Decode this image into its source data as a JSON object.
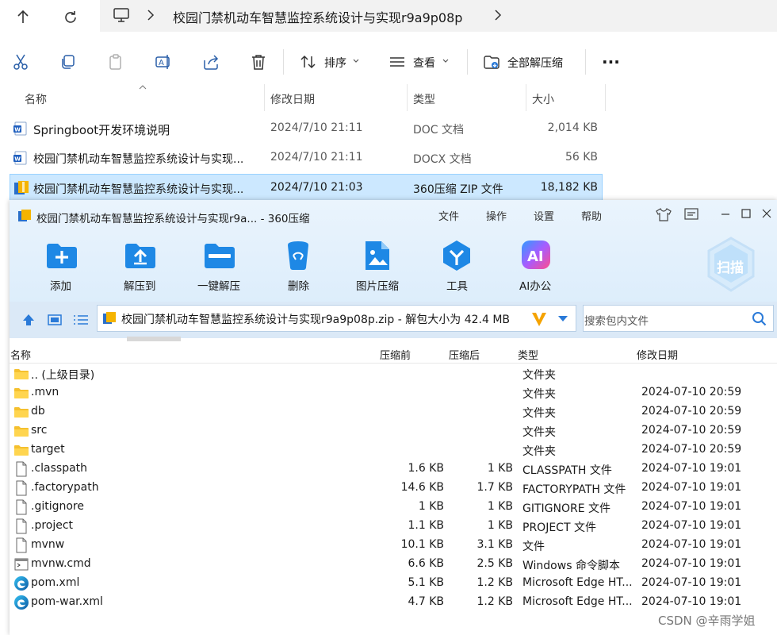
{
  "explorer": {
    "breadcrumb": "校园门禁机动车智慧监控系统设计与实现r9a9p08p",
    "toolbar": {
      "sort": "排序",
      "view": "查看",
      "extract_all": "全部解压缩",
      "more": "..."
    },
    "columns": {
      "name": "名称",
      "date": "修改日期",
      "type": "类型",
      "size": "大小"
    },
    "files": [
      {
        "name": "Springboot开发环境说明",
        "date": "2024/7/10 21:11",
        "type": "DOC 文档",
        "size": "2,014 KB",
        "icon": "word-doc-icon"
      },
      {
        "name": "校园门禁机动车智慧监控系统设计与实现...",
        "date": "2024/7/10 21:11",
        "type": "DOCX 文档",
        "size": "56 KB",
        "icon": "word-doc-icon"
      },
      {
        "name": "校园门禁机动车智慧监控系统设计与实现...",
        "date": "2024/7/10 21:03",
        "type": "360压缩 ZIP 文件",
        "size": "18,182 KB",
        "icon": "zip-archive-icon",
        "selected": true
      }
    ]
  },
  "zipwin": {
    "title": "校园门禁机动车智慧监控系统设计与实现r9a... - 360压缩",
    "menu": [
      "文件",
      "操作",
      "设置",
      "帮助"
    ],
    "tools": [
      "添加",
      "解压到",
      "一键解压",
      "删除",
      "图片压缩",
      "工具",
      "AI办公"
    ],
    "scan": "扫描",
    "path": "校园门禁机动车智慧监控系统设计与实现r9a9p08p.zip - 解包大小为 42.4 MB",
    "search_placeholder": "搜索包内文件",
    "columns": {
      "name": "名称",
      "before": "压缩前",
      "after": "压缩后",
      "type": "类型",
      "date": "修改日期"
    },
    "rows": [
      {
        "name": ".. (上级目录)",
        "before": "",
        "after": "",
        "type": "文件夹",
        "date": "",
        "icon": "folder-icon"
      },
      {
        "name": ".mvn",
        "before": "",
        "after": "",
        "type": "文件夹",
        "date": "2024-07-10 20:59",
        "icon": "folder-icon"
      },
      {
        "name": "db",
        "before": "",
        "after": "",
        "type": "文件夹",
        "date": "2024-07-10 20:59",
        "icon": "folder-icon"
      },
      {
        "name": "src",
        "before": "",
        "after": "",
        "type": "文件夹",
        "date": "2024-07-10 20:59",
        "icon": "folder-icon"
      },
      {
        "name": "target",
        "before": "",
        "after": "",
        "type": "文件夹",
        "date": "2024-07-10 20:59",
        "icon": "folder-icon"
      },
      {
        "name": ".classpath",
        "before": "1.6 KB",
        "after": "1 KB",
        "type": "CLASSPATH 文件",
        "date": "2024-07-10 19:01",
        "icon": "file-icon"
      },
      {
        "name": ".factorypath",
        "before": "14.6 KB",
        "after": "1.7 KB",
        "type": "FACTORYPATH 文件",
        "date": "2024-07-10 19:01",
        "icon": "file-icon"
      },
      {
        "name": ".gitignore",
        "before": "1 KB",
        "after": "1 KB",
        "type": "GITIGNORE 文件",
        "date": "2024-07-10 19:01",
        "icon": "file-icon"
      },
      {
        "name": ".project",
        "before": "1.1 KB",
        "after": "1 KB",
        "type": "PROJECT 文件",
        "date": "2024-07-10 19:01",
        "icon": "file-icon"
      },
      {
        "name": "mvnw",
        "before": "10.1 KB",
        "after": "3.1 KB",
        "type": "文件",
        "date": "2024-07-10 19:01",
        "icon": "file-icon"
      },
      {
        "name": "mvnw.cmd",
        "before": "6.6 KB",
        "after": "2.5 KB",
        "type": "Windows 命令脚本",
        "date": "2024-07-10 19:01",
        "icon": "cmd-script-icon"
      },
      {
        "name": "pom.xml",
        "before": "5.1 KB",
        "after": "1.2 KB",
        "type": "Microsoft Edge HT...",
        "date": "2024-07-10 19:01",
        "icon": "edge-icon"
      },
      {
        "name": "pom-war.xml",
        "before": "4.7 KB",
        "after": "1.2 KB",
        "type": "Microsoft Edge HT...",
        "date": "2024-07-10 19:01",
        "icon": "edge-icon"
      }
    ]
  },
  "watermark": "CSDN @辛雨学姐"
}
